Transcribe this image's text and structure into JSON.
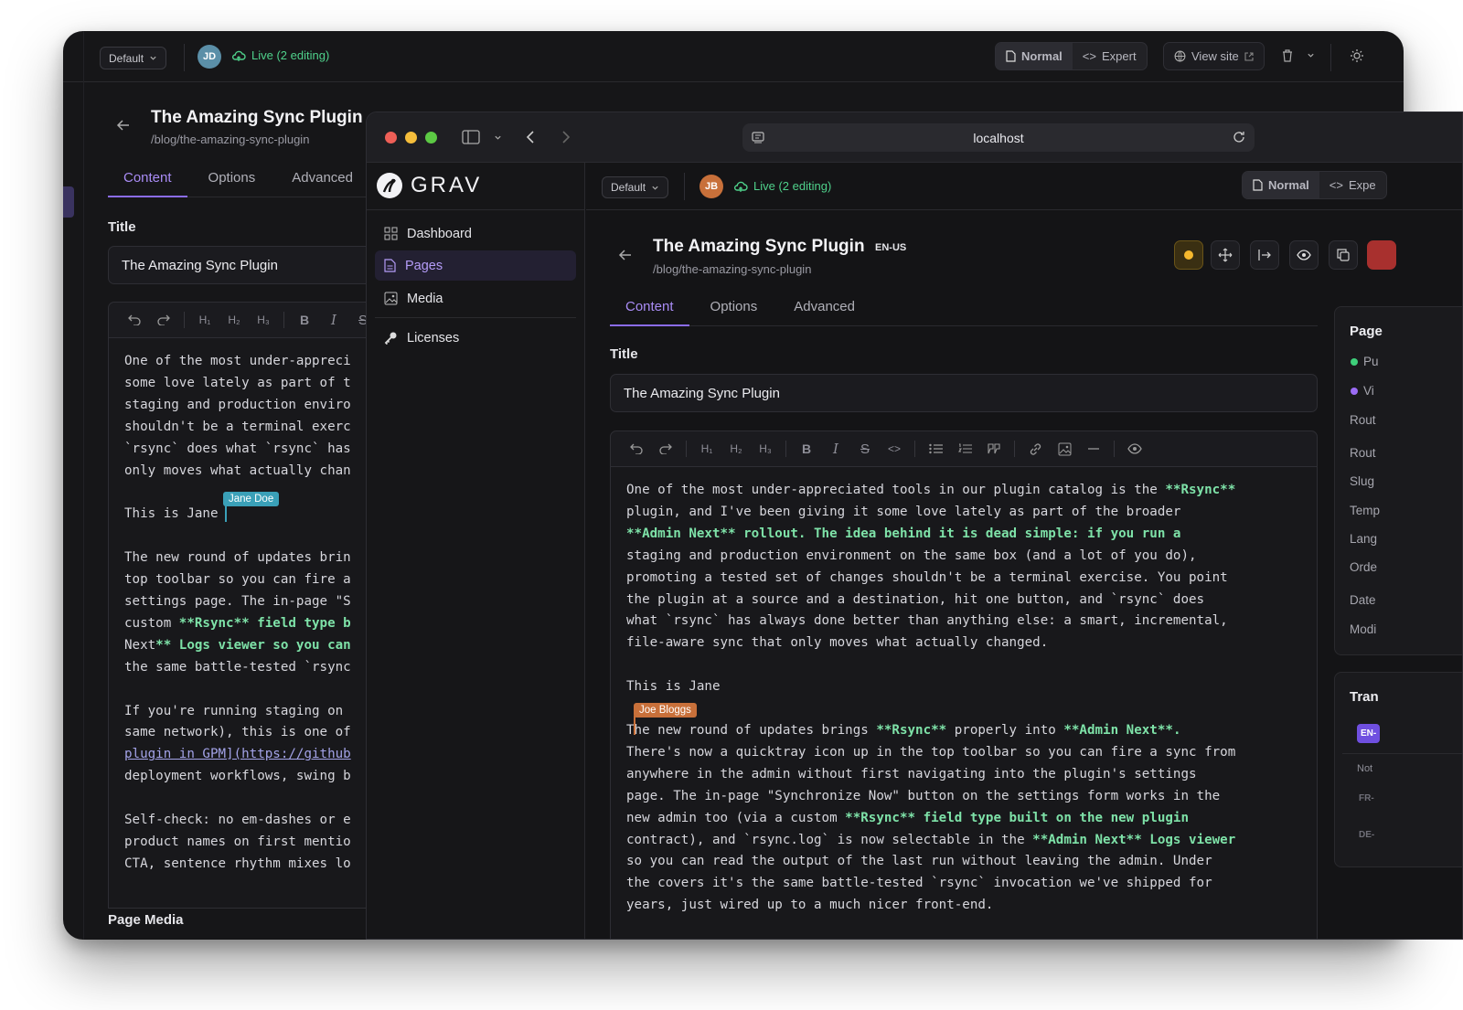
{
  "back_window": {
    "toolbar": {
      "lang_select": "Default",
      "avatar_initials": "JD",
      "live_status": "Live (2 editing)",
      "mode_normal": "Normal",
      "mode_expert": "Expert",
      "view_site": "View site"
    },
    "page_title": "The Amazing Sync Plugin",
    "page_path": "/blog/the-amazing-sync-plugin",
    "tabs": [
      "Content",
      "Options",
      "Advanced"
    ],
    "title_label": "Title",
    "title_value": "The Amazing Sync Plugin",
    "editor_lines": [
      "One of the most under-appreci",
      "some love lately as part of t",
      "staging and production enviro",
      "shouldn't be a terminal exerc",
      "`rsync` does what `rsync` has",
      "only moves what actually chan",
      "",
      "This is Jane",
      "",
      "The new round of updates brin",
      "top toolbar so you can fire a",
      "settings page. The in-page \"S",
      "custom **Rsync** field type b",
      "Next** Logs viewer so you can",
      "the same battle-tested `rsync",
      "",
      "If you're running staging on",
      "same network), this is one of",
      "plugin in GPM](https://github",
      "deployment workflows, swing b",
      "",
      "Self-check: no em-dashes or e",
      "product names on first mentio",
      "CTA, sentence rhythm mixes lo"
    ],
    "cursor_user": "Jane Doe",
    "section_below": "Page Media"
  },
  "browser": {
    "url": "localhost",
    "brand": "GRAV",
    "nav": [
      {
        "label": "Dashboard",
        "icon": "dashboard-icon"
      },
      {
        "label": "Pages",
        "icon": "pages-icon"
      },
      {
        "label": "Media",
        "icon": "media-icon"
      },
      {
        "label": "Licenses",
        "icon": "key-icon"
      }
    ],
    "toolbar": {
      "lang_select": "Default",
      "avatar_initials": "JB",
      "live_status": "Live (2 editing)",
      "mode_normal": "Normal",
      "mode_expert": "Expe"
    },
    "page_title": "The Amazing Sync Plugin",
    "lang_badge": "EN-US",
    "page_path": "/blog/the-amazing-sync-plugin",
    "tabs": [
      "Content",
      "Options",
      "Advanced"
    ],
    "title_label": "Title",
    "title_value": "The Amazing Sync Plugin",
    "editor_lines": [
      "One of the most under-appreciated tools in our plugin catalog is the **Rsync**",
      "plugin, and I've been giving it some love lately as part of the broader",
      "**Admin Next** rollout. The idea behind it is dead simple: if you run a",
      "staging and production environment on the same box (and a lot of you do),",
      "promoting a tested set of changes shouldn't be a terminal exercise. You point",
      "the plugin at a source and a destination, hit one button, and `rsync` does",
      "what `rsync` has always done better than anything else: a smart, incremental,",
      "file-aware sync that only moves what actually changed.",
      "",
      "This is Jane",
      "",
      "The new round of updates brings **Rsync** properly into **Admin Next**.",
      "There's now a quicktray icon up in the top toolbar so you can fire a sync from",
      "anywhere in the admin without first navigating into the plugin's settings",
      "page. The in-page \"Synchronize Now\" button on the settings form works in the",
      "new admin too (via a custom **Rsync** field type built on the new plugin",
      "contract), and `rsync.log` is now selectable in the **Admin Next** Logs viewer",
      "so you can read the output of the last run without leaving the admin. Under",
      "the covers it's the same battle-tested `rsync` invocation we've shipped for",
      "years, just wired up to a much nicer front-end."
    ],
    "cursor_user": "Joe Bloggs",
    "right_panel": {
      "heading": "Page",
      "items": [
        "Pu",
        "Vi",
        "Rout",
        "Rout",
        "Slug",
        "Temp",
        "Lang",
        "Orde",
        "Date",
        "Modi"
      ],
      "trans_heading": "Tran",
      "trans_badge": "EN-",
      "trans_items": [
        "Not",
        "FR-",
        "DE-"
      ]
    },
    "colors": {
      "accent": "#8b6cf0",
      "live": "#4fd18b",
      "published": "#3ecf7a",
      "visible": "#9b6cf5",
      "jane": "#3aa0b8",
      "joe": "#c8703a"
    }
  }
}
